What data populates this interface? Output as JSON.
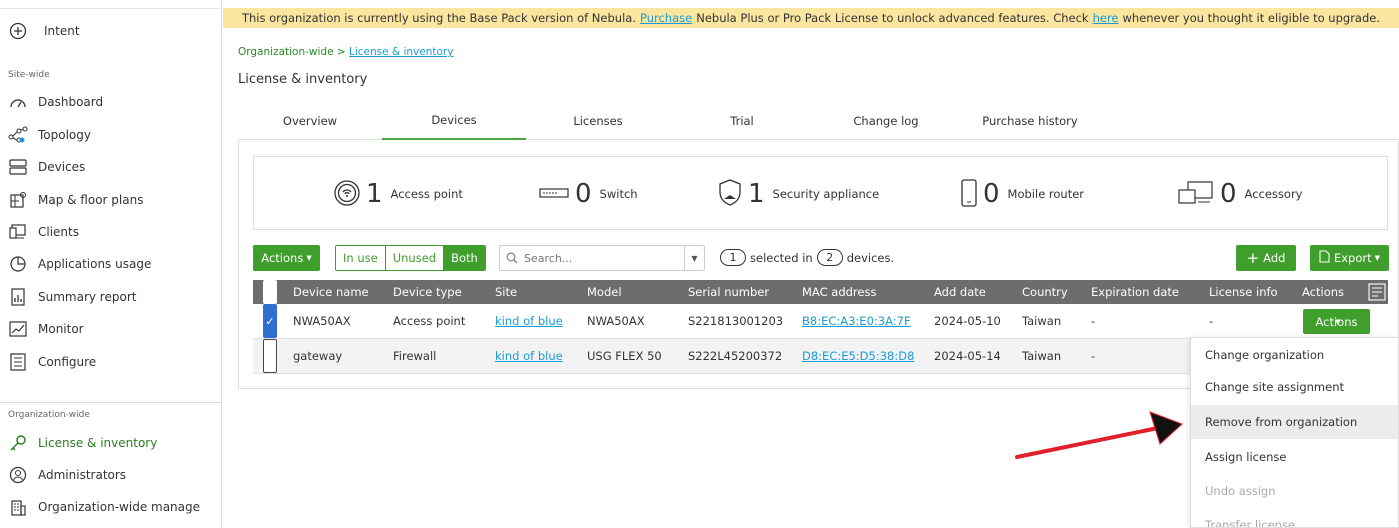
{
  "sidebar": {
    "intent": "Intent",
    "site_wide_section": "Site-wide",
    "site_items": [
      "Dashboard",
      "Topology",
      "Devices",
      "Map & floor plans",
      "Clients",
      "Applications usage",
      "Summary report",
      "Monitor",
      "Configure"
    ],
    "org_section": "Organization-wide",
    "org_items": [
      "License & inventory",
      "Administrators",
      "Organization-wide manage"
    ],
    "active_item": "License & inventory"
  },
  "banner": {
    "text_before": "This organization is currently using the Base Pack version of Nebula.",
    "purchase_link": "Purchase",
    "text_middle": "Nebula Plus or Pro Pack License to unlock advanced features. Check",
    "here_link": "here",
    "text_after": "whenever you thought it eligible to upgrade."
  },
  "breadcrumb": {
    "root": "Organization-wide >",
    "current": "License & inventory"
  },
  "page_title": "License & inventory",
  "tabs": [
    "Overview",
    "Devices",
    "Licenses",
    "Trial",
    "Change log",
    "Purchase history"
  ],
  "active_tab": "Devices",
  "summary": [
    {
      "count": "1",
      "label": "Access point",
      "icon": "access-point-icon"
    },
    {
      "count": "0",
      "label": "Switch",
      "icon": "switch-icon"
    },
    {
      "count": "1",
      "label": "Security appliance",
      "icon": "security-appliance-icon"
    },
    {
      "count": "0",
      "label": "Mobile router",
      "icon": "mobile-router-icon"
    },
    {
      "count": "0",
      "label": "Accessory",
      "icon": "accessory-icon"
    }
  ],
  "toolbar": {
    "actions_label": "Actions",
    "filter_options": [
      "In use",
      "Unused",
      "Both"
    ],
    "filter_selected": "Both",
    "search_placeholder": "Search...",
    "selected_count": "1",
    "selected_in": "selected in",
    "total_count": "2",
    "devices_suffix": "devices.",
    "add_label": "Add",
    "export_label": "Export"
  },
  "table": {
    "columns": [
      "Device name",
      "Device type",
      "Site",
      "Model",
      "Serial number",
      "MAC address",
      "Add date",
      "Country",
      "Expiration date",
      "License info",
      "Actions"
    ],
    "rows": [
      {
        "checked": true,
        "name": "NWA50AX",
        "type": "Access point",
        "site": "kind of blue",
        "model": "NWA50AX",
        "serial": "S221813001203",
        "mac": "B8:EC:A3:E0:3A:7F",
        "add_date": "2024-05-10",
        "country": "Taiwan",
        "expiration": "-",
        "license": "-",
        "action": "Actions"
      },
      {
        "checked": false,
        "name": "gateway",
        "type": "Firewall",
        "site": "kind of blue",
        "model": "USG FLEX 50",
        "serial": "S222L45200372",
        "mac": "D8:EC:E5:D5:38:D8",
        "add_date": "2024-05-14",
        "country": "Taiwan",
        "expiration": "-",
        "license": "",
        "action": ""
      }
    ]
  },
  "actions_menu": {
    "items": [
      "Change organization",
      "Change site assignment",
      "Remove from organization",
      "Assign license",
      "Undo assign",
      "Transfer license"
    ],
    "highlighted": "Remove from organization",
    "disabled": [
      "Undo assign",
      "Transfer license"
    ]
  },
  "colors": {
    "accent_green": "#3f9e2c",
    "banner_yellow": "#fbe6a0",
    "link_blue": "#1a9bd7",
    "annotation_red": "#e0202a"
  }
}
